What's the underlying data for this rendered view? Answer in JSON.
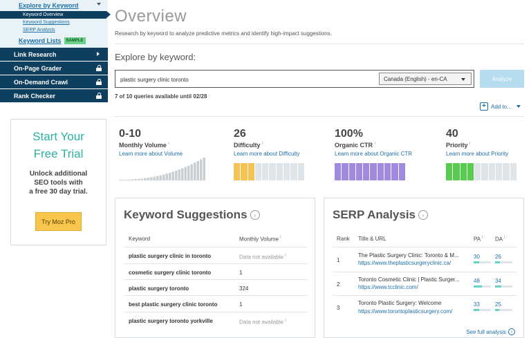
{
  "sidebar": {
    "explore": "Explore by Keyword",
    "sub_items": [
      "Keyword Overview",
      "Keyword Suggestions",
      "SERP Analysis"
    ],
    "keyword_lists": "Keyword Lists",
    "sample_badge": "SAMPLE",
    "nav": [
      "Link Research",
      "On-Page Grader",
      "On-Demand Crawl",
      "Rank Checker"
    ]
  },
  "trial": {
    "title_line1": "Start Your",
    "title_line2": "Free Trial",
    "text1": "Unlock additional",
    "text2": "SEO tools with",
    "text3": "a free 30 day trial.",
    "button": "Try Moz Pro"
  },
  "page": {
    "title": "Overview",
    "desc": "Research by keyword to analyze predictive metrics and identify high-impact suggestions.",
    "explore_label": "Explore by keyword:",
    "query": "plastic surgery clinic toronto",
    "locale": "Canada (English) - en-CA",
    "analyze": "Analyze",
    "quota": "7 of 10 queries available until 02/28",
    "add_to": "Add to..."
  },
  "metrics": [
    {
      "value": "0-10",
      "label": "Monthly Volume",
      "link": "Learn more about Volume"
    },
    {
      "value": "26",
      "label": "Difficulty",
      "link": "Learn more about Difficulty",
      "filled": 3,
      "color": "#f3c453"
    },
    {
      "value": "100%",
      "label": "Organic CTR",
      "link": "Learn more about Organic CTR",
      "filled": 10,
      "color": "#a08ae0"
    },
    {
      "value": "40",
      "label": "Priority",
      "link": "Learn more about Priority",
      "filled": 4,
      "color": "#58cc4f"
    }
  ],
  "suggestions": {
    "title": "Keyword Suggestions",
    "col_keyword": "Keyword",
    "col_volume": "Monthly Volume",
    "rows": [
      {
        "kw": "plastic surgery clinic in toronto",
        "vol": "Data not available"
      },
      {
        "kw": "cosmetic surgery clinic toronto",
        "vol": "1"
      },
      {
        "kw": "plastic surgery toronto",
        "vol": "324"
      },
      {
        "kw": "best plastic surgery clinic toronto",
        "vol": "1"
      },
      {
        "kw": "plastic surgery toronto yorkville",
        "vol": "Data not available"
      }
    ]
  },
  "serp": {
    "title": "SERP Analysis",
    "col_rank": "Rank",
    "col_title": "Title & URL",
    "col_pa": "PA",
    "col_da": "DA",
    "rows": [
      {
        "rank": "1",
        "title": "The Plastic Surgery Clinic: Toronto & M...",
        "url": "https://www.theplasticsurgeryclinic.ca/",
        "pa": "30",
        "da": "26",
        "pa_frac": 0.3,
        "da_frac": 0.26
      },
      {
        "rank": "2",
        "title": "Toronto Cosmetic Clinic | Plastic Surger...",
        "url": "https://www.tcclinic.com/",
        "pa": "48",
        "da": "34",
        "pa_frac": 0.48,
        "da_frac": 0.34
      },
      {
        "rank": "3",
        "title": "Toronto Plastic Surgery: Welcome",
        "url": "https://www.torontoplasticsurgery.com/",
        "pa": "33",
        "da": "25",
        "pa_frac": 0.33,
        "da_frac": 0.25
      }
    ],
    "see_full": "See full analysis"
  }
}
